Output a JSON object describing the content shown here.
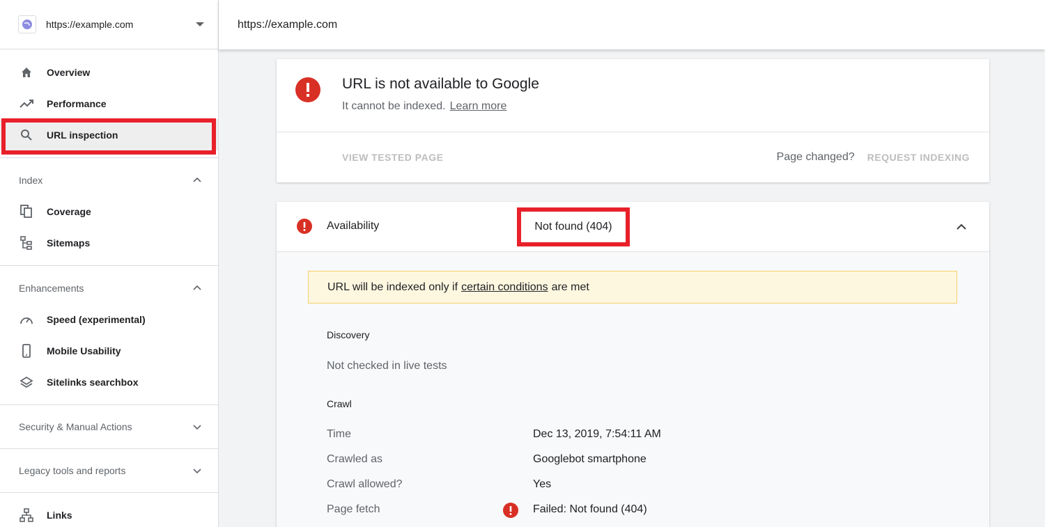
{
  "property": {
    "url": "https://example.com"
  },
  "sidebar": {
    "main": [
      {
        "label": "Overview",
        "icon": "home-icon"
      },
      {
        "label": "Performance",
        "icon": "trending-up-icon"
      },
      {
        "label": "URL inspection",
        "icon": "search-icon"
      }
    ],
    "index": {
      "title": "Index",
      "items": [
        {
          "label": "Coverage",
          "icon": "coverage-icon"
        },
        {
          "label": "Sitemaps",
          "icon": "sitemap-icon"
        }
      ]
    },
    "enhancements": {
      "title": "Enhancements",
      "items": [
        {
          "label": "Speed (experimental)",
          "icon": "speed-icon"
        },
        {
          "label": "Mobile Usability",
          "icon": "phone-icon"
        },
        {
          "label": "Sitelinks searchbox",
          "icon": "layers-icon"
        }
      ]
    },
    "security": {
      "title": "Security & Manual Actions"
    },
    "legacy": {
      "title": "Legacy tools and reports"
    },
    "links": {
      "label": "Links",
      "icon": "links-icon"
    }
  },
  "topbar": {
    "url": "https://example.com"
  },
  "summary": {
    "title": "URL is not available to Google",
    "subtitle": "It cannot be indexed.",
    "learn_more": "Learn more",
    "view_tested": "VIEW TESTED PAGE",
    "page_changed": "Page changed?",
    "request_indexing": "REQUEST INDEXING"
  },
  "availability": {
    "label": "Availability",
    "status": "Not found (404)",
    "warning_pre": "URL will be indexed only if",
    "warning_link": "certain conditions",
    "warning_post": "are met",
    "discovery_title": "Discovery",
    "discovery_value": "Not checked in live tests",
    "crawl_title": "Crawl",
    "crawl": [
      {
        "key": "Time",
        "value": "Dec 13, 2019, 7:54:11 AM"
      },
      {
        "key": "Crawled as",
        "value": "Googlebot smartphone"
      },
      {
        "key": "Crawl allowed?",
        "value": "Yes"
      },
      {
        "key": "Page fetch",
        "value": "Failed: Not found (404)"
      }
    ]
  },
  "colors": {
    "error": "#d93025",
    "highlight": "#e8202a",
    "warning_bg": "#fef7e0"
  }
}
